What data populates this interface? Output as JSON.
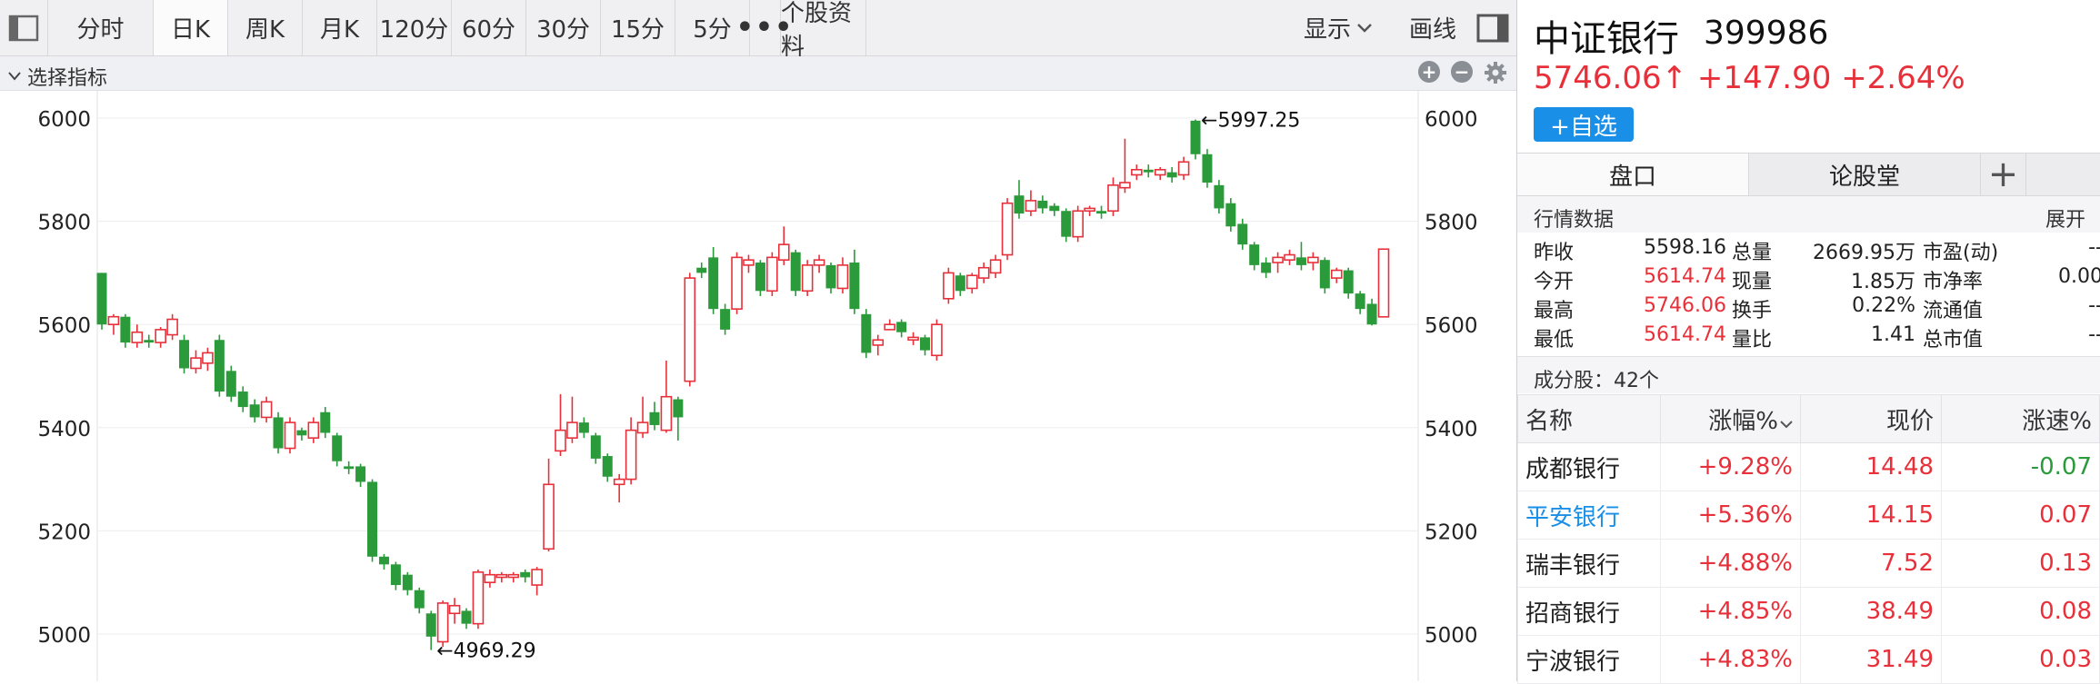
{
  "toolbar": {
    "tabs": [
      {
        "label": "分时",
        "active": false
      },
      {
        "label": "日K",
        "active": true
      },
      {
        "label": "周K",
        "active": false
      },
      {
        "label": "月K",
        "active": false
      },
      {
        "label": "120分",
        "active": false
      },
      {
        "label": "60分",
        "active": false
      },
      {
        "label": "30分",
        "active": false
      },
      {
        "label": "15分",
        "active": false
      },
      {
        "label": "5分",
        "active": false
      },
      {
        "label": "•••",
        "active": false
      },
      {
        "label": "个股资料",
        "active": false
      }
    ],
    "display_label": "显示",
    "draw_label": "画线"
  },
  "indicator_bar": {
    "label": "选择指标"
  },
  "colors": {
    "up": "#e8303a",
    "down": "#2a9a3a",
    "accent": "#1a8fe8"
  },
  "chart_data": {
    "type": "candlestick",
    "ylim": [
      4960,
      6010
    ],
    "yticks": [
      "6000",
      "5800",
      "5600",
      "5400",
      "5200",
      "5000"
    ],
    "max_marker": "←5997.25",
    "min_marker": "←4969.29",
    "candles": [
      [
        5700,
        5600,
        5590,
        5700
      ],
      [
        5600,
        5615,
        5580,
        5620
      ],
      [
        5615,
        5565,
        5555,
        5620
      ],
      [
        5565,
        5585,
        5555,
        5600
      ],
      [
        5570,
        5565,
        5555,
        5580
      ],
      [
        5565,
        5590,
        5555,
        5595
      ],
      [
        5580,
        5610,
        5570,
        5620
      ],
      [
        5570,
        5515,
        5505,
        5580
      ],
      [
        5515,
        5535,
        5505,
        5550
      ],
      [
        5525,
        5545,
        5510,
        5555
      ],
      [
        5570,
        5470,
        5460,
        5580
      ],
      [
        5510,
        5460,
        5450,
        5520
      ],
      [
        5470,
        5440,
        5430,
        5480
      ],
      [
        5445,
        5420,
        5410,
        5455
      ],
      [
        5420,
        5450,
        5410,
        5460
      ],
      [
        5420,
        5360,
        5350,
        5430
      ],
      [
        5360,
        5410,
        5350,
        5420
      ],
      [
        5395,
        5385,
        5375,
        5400
      ],
      [
        5380,
        5410,
        5370,
        5420
      ],
      [
        5430,
        5390,
        5380,
        5440
      ],
      [
        5385,
        5335,
        5325,
        5390
      ],
      [
        5325,
        5320,
        5310,
        5335
      ],
      [
        5325,
        5295,
        5285,
        5330
      ],
      [
        5295,
        5150,
        5140,
        5300
      ],
      [
        5150,
        5135,
        5125,
        5155
      ],
      [
        5135,
        5095,
        5085,
        5140
      ],
      [
        5115,
        5085,
        5075,
        5120
      ],
      [
        5085,
        5050,
        5040,
        5090
      ],
      [
        5040,
        4995,
        4969,
        5045
      ],
      [
        4985,
        5060,
        4975,
        5065
      ],
      [
        5040,
        5055,
        5020,
        5070
      ],
      [
        5045,
        5020,
        5010,
        5050
      ],
      [
        5020,
        5120,
        5010,
        5125
      ],
      [
        5100,
        5115,
        5090,
        5125
      ],
      [
        5110,
        5115,
        5100,
        5120
      ],
      [
        5110,
        5115,
        5100,
        5120
      ],
      [
        5120,
        5110,
        5100,
        5125
      ],
      [
        5095,
        5125,
        5075,
        5130
      ],
      [
        5165,
        5290,
        5160,
        5340
      ],
      [
        5355,
        5395,
        5345,
        5465
      ],
      [
        5380,
        5410,
        5370,
        5460
      ],
      [
        5410,
        5390,
        5380,
        5420
      ],
      [
        5385,
        5340,
        5330,
        5390
      ],
      [
        5345,
        5305,
        5295,
        5350
      ],
      [
        5290,
        5300,
        5255,
        5310
      ],
      [
        5300,
        5395,
        5290,
        5420
      ],
      [
        5390,
        5410,
        5380,
        5460
      ],
      [
        5430,
        5405,
        5395,
        5450
      ],
      [
        5395,
        5460,
        5390,
        5530
      ],
      [
        5455,
        5420,
        5375,
        5460
      ],
      [
        5490,
        5690,
        5480,
        5700
      ],
      [
        5710,
        5700,
        5690,
        5720
      ],
      [
        5730,
        5630,
        5620,
        5750
      ],
      [
        5630,
        5590,
        5580,
        5640
      ],
      [
        5630,
        5730,
        5620,
        5740
      ],
      [
        5715,
        5725,
        5700,
        5735
      ],
      [
        5720,
        5665,
        5655,
        5725
      ],
      [
        5665,
        5730,
        5655,
        5740
      ],
      [
        5725,
        5755,
        5715,
        5790
      ],
      [
        5740,
        5665,
        5655,
        5745
      ],
      [
        5665,
        5715,
        5655,
        5725
      ],
      [
        5715,
        5725,
        5700,
        5735
      ],
      [
        5715,
        5670,
        5660,
        5720
      ],
      [
        5670,
        5715,
        5660,
        5730
      ],
      [
        5720,
        5630,
        5620,
        5745
      ],
      [
        5620,
        5545,
        5535,
        5630
      ],
      [
        5560,
        5570,
        5540,
        5580
      ],
      [
        5590,
        5600,
        5590,
        5610
      ],
      [
        5605,
        5585,
        5575,
        5610
      ],
      [
        5570,
        5575,
        5560,
        5585
      ],
      [
        5575,
        5550,
        5540,
        5580
      ],
      [
        5540,
        5600,
        5530,
        5610
      ],
      [
        5650,
        5700,
        5640,
        5710
      ],
      [
        5695,
        5665,
        5655,
        5700
      ],
      [
        5670,
        5695,
        5660,
        5700
      ],
      [
        5690,
        5710,
        5680,
        5720
      ],
      [
        5700,
        5725,
        5690,
        5735
      ],
      [
        5735,
        5835,
        5725,
        5845
      ],
      [
        5850,
        5815,
        5805,
        5880
      ],
      [
        5820,
        5840,
        5810,
        5860
      ],
      [
        5840,
        5825,
        5815,
        5850
      ],
      [
        5830,
        5820,
        5810,
        5835
      ],
      [
        5820,
        5770,
        5760,
        5825
      ],
      [
        5770,
        5820,
        5760,
        5830
      ],
      [
        5820,
        5825,
        5810,
        5830
      ],
      [
        5820,
        5815,
        5805,
        5830
      ],
      [
        5820,
        5870,
        5810,
        5885
      ],
      [
        5865,
        5875,
        5855,
        5960
      ],
      [
        5890,
        5900,
        5880,
        5910
      ],
      [
        5900,
        5895,
        5885,
        5910
      ],
      [
        5890,
        5900,
        5880,
        5905
      ],
      [
        5895,
        5885,
        5875,
        5905
      ],
      [
        5890,
        5915,
        5880,
        5925
      ],
      [
        5995,
        5930,
        5920,
        5997.25
      ],
      [
        5930,
        5875,
        5865,
        5940
      ],
      [
        5870,
        5825,
        5815,
        5880
      ],
      [
        5835,
        5790,
        5780,
        5845
      ],
      [
        5795,
        5755,
        5745,
        5805
      ],
      [
        5755,
        5715,
        5705,
        5760
      ],
      [
        5720,
        5700,
        5690,
        5730
      ],
      [
        5720,
        5730,
        5700,
        5740
      ],
      [
        5725,
        5735,
        5715,
        5745
      ],
      [
        5730,
        5715,
        5705,
        5760
      ],
      [
        5720,
        5730,
        5705,
        5740
      ],
      [
        5725,
        5670,
        5660,
        5730
      ],
      [
        5690,
        5705,
        5680,
        5710
      ],
      [
        5705,
        5660,
        5650,
        5710
      ],
      [
        5660,
        5630,
        5620,
        5665
      ],
      [
        5640,
        5600,
        5598,
        5650
      ],
      [
        5614.74,
        5746.06,
        5614.74,
        5746.06
      ]
    ]
  },
  "quote": {
    "name": "中证银行",
    "code": "399986",
    "price": "5746.06↑",
    "change": "+147.90",
    "change_pct": "+2.64%",
    "fav_label": "+自选"
  },
  "right_tabs": [
    {
      "label": "盘口",
      "active": true
    },
    {
      "label": "论股堂",
      "active": false
    },
    {
      "label": "+",
      "active": false
    }
  ],
  "market": {
    "title": "行情数据",
    "expand": "展开",
    "rows": [
      {
        "l1": "昨收",
        "v1": "5598.16",
        "l2": "总量",
        "v2": "2669.95万",
        "l3": "市盈(动)",
        "v3": "--",
        "c1": "plain"
      },
      {
        "l1": "今开",
        "v1": "5614.74",
        "l2": "现量",
        "v2": "1.85万",
        "l3": "市净率",
        "v3": "0.00",
        "c1": "red"
      },
      {
        "l1": "最高",
        "v1": "5746.06",
        "l2": "换手",
        "v2": "0.22%",
        "l3": "流通值",
        "v3": "--",
        "c1": "red"
      },
      {
        "l1": "最低",
        "v1": "5614.74",
        "l2": "量比",
        "v2": "1.41",
        "l3": "总市值",
        "v3": "--",
        "c1": "red"
      }
    ]
  },
  "components": {
    "title": "成分股：42个",
    "headers": [
      "名称",
      "涨幅%",
      "现价",
      "涨速%"
    ],
    "rows": [
      {
        "name": "成都银行",
        "pct": "+9.28%",
        "price": "14.48",
        "speed": "-0.07",
        "name_color": "plain",
        "speed_color": "green"
      },
      {
        "name": "平安银行",
        "pct": "+5.36%",
        "price": "14.15",
        "speed": "0.07",
        "name_color": "blue",
        "speed_color": "red"
      },
      {
        "name": "瑞丰银行",
        "pct": "+4.88%",
        "price": "7.52",
        "speed": "0.13",
        "name_color": "plain",
        "speed_color": "red"
      },
      {
        "name": "招商银行",
        "pct": "+4.85%",
        "price": "38.49",
        "speed": "0.08",
        "name_color": "plain",
        "speed_color": "red"
      },
      {
        "name": "宁波银行",
        "pct": "+4.83%",
        "price": "31.49",
        "speed": "0.03",
        "name_color": "plain",
        "speed_color": "red"
      }
    ]
  }
}
